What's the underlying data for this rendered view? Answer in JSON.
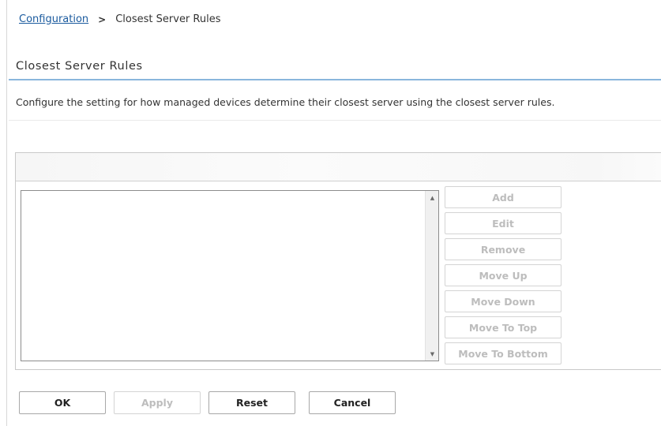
{
  "breadcrumb": {
    "link": "Configuration",
    "separator": ">",
    "current": "Closest Server Rules"
  },
  "page": {
    "title": "Closest Server Rules",
    "description": "Configure the setting for how managed devices determine their closest server using the closest server rules."
  },
  "rules_list": {
    "items": [],
    "scroll_up_icon": "▲",
    "scroll_down_icon": "▼"
  },
  "side_buttons": {
    "add": "Add",
    "edit": "Edit",
    "remove": "Remove",
    "move_up": "Move Up",
    "move_down": "Move Down",
    "move_to_top": "Move To Top",
    "move_to_bottom": "Move To Bottom"
  },
  "footer": {
    "ok": "OK",
    "apply": "Apply",
    "reset": "Reset",
    "cancel": "Cancel"
  },
  "colors": {
    "link": "#1a5a9e",
    "title_rule": "#8ab6dd",
    "disabled_text": "#bdbdbd"
  }
}
